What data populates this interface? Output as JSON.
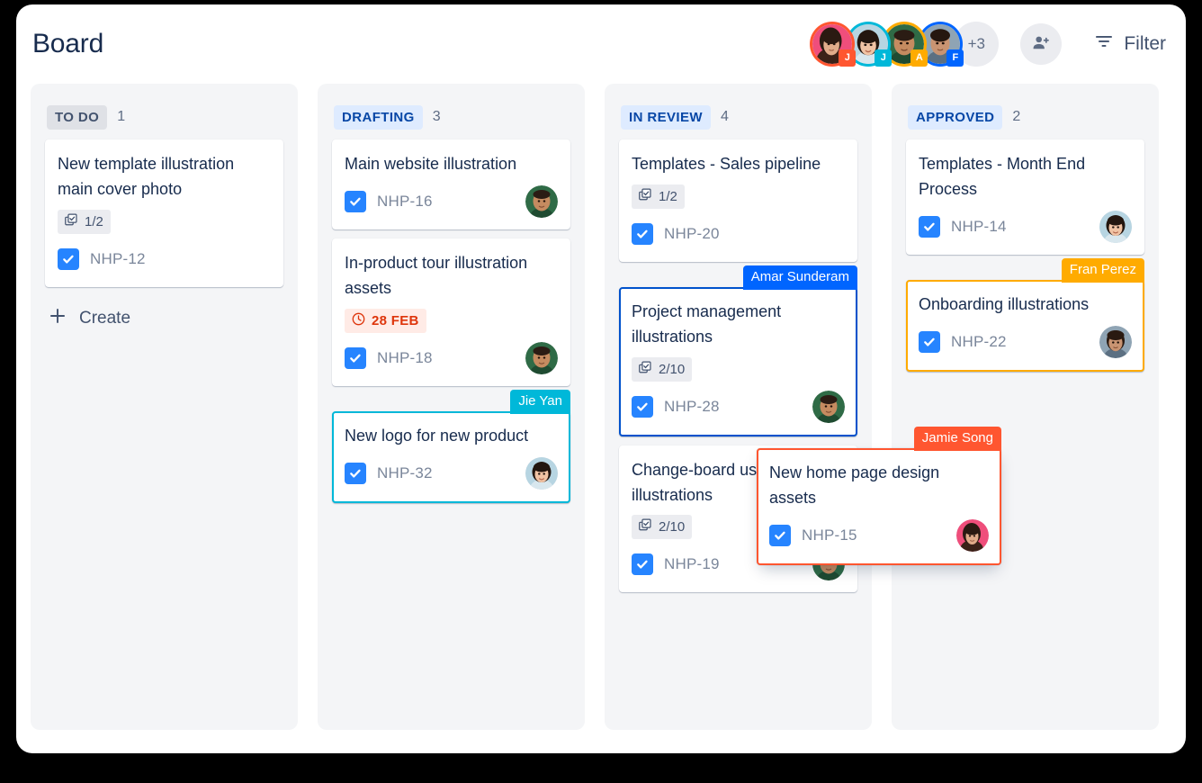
{
  "header": {
    "title": "Board",
    "avatars": [
      {
        "name": "Jamie Song",
        "initial": "J",
        "ring": "#ff5630",
        "badge": "#ff5630"
      },
      {
        "name": "Jie Yan",
        "initial": "J",
        "ring": "#00b8d9",
        "badge": "#00b8d9"
      },
      {
        "name": "Amar Sunderam",
        "initial": "A",
        "ring": "#ffab00",
        "badge": "#ffab00"
      },
      {
        "name": "Fran Perez",
        "initial": "F",
        "ring": "#0065ff",
        "badge": "#0065ff"
      }
    ],
    "more_count": "+3",
    "add_person_icon": "add-person-icon",
    "filter_icon": "filter-icon",
    "filter_label": "Filter"
  },
  "columns": [
    {
      "id": "todo",
      "name": "TO DO",
      "badge_style": "todo",
      "count": "1",
      "create_label": "Create",
      "create_icon": "plus-icon",
      "cards": [
        {
          "title": "New template illustration main cover photo",
          "subtasks": "1/2",
          "subtasks_icon": "subtasks-icon",
          "key": "NHP-12",
          "type_icon": "task-check-icon",
          "avatar": null,
          "owner_tag": null,
          "highlight": null
        }
      ]
    },
    {
      "id": "drafting",
      "name": "DRAFTING",
      "badge_style": "status",
      "count": "3",
      "cards": [
        {
          "title": "Main website illustration",
          "subtasks": null,
          "key": "NHP-16",
          "type_icon": "task-check-icon",
          "avatar": "man-green",
          "owner_tag": null,
          "highlight": null
        },
        {
          "title": "In-product tour illustration assets",
          "due_date": "28 FEB",
          "due_icon": "clock-icon",
          "key": "NHP-18",
          "type_icon": "task-check-icon",
          "avatar": "man-green",
          "owner_tag": null,
          "highlight": null
        },
        {
          "title": "New logo for new product",
          "subtasks": null,
          "key": "NHP-32",
          "type_icon": "task-check-icon",
          "avatar": "woman-cyan",
          "owner_tag": "Jie Yan",
          "owner_tag_color": "cyan",
          "highlight": "sel-cyan"
        }
      ]
    },
    {
      "id": "inreview",
      "name": "IN REVIEW",
      "badge_style": "status",
      "count": "4",
      "cards": [
        {
          "title": "Templates - Sales pipeline",
          "subtasks": "1/2",
          "subtasks_icon": "subtasks-icon",
          "key": "NHP-20",
          "type_icon": "task-check-icon",
          "avatar": null,
          "owner_tag": null,
          "highlight": null
        },
        {
          "title": "Project management illustrations",
          "subtasks": "2/10",
          "subtasks_icon": "subtasks-icon",
          "key": "NHP-28",
          "type_icon": "task-check-icon",
          "avatar": "man-green",
          "owner_tag": "Amar Sunderam",
          "owner_tag_color": "blue",
          "highlight": "sel-blue"
        },
        {
          "title": "Change-board users illustrations",
          "subtasks": "2/10",
          "subtasks_icon": "subtasks-icon",
          "key": "NHP-19",
          "type_icon": "task-check-icon",
          "avatar": "man-green",
          "owner_tag": null,
          "highlight": null
        }
      ]
    },
    {
      "id": "approved",
      "name": "APPROVED",
      "badge_style": "status",
      "count": "2",
      "cards": [
        {
          "title": "Templates - Month End Process",
          "subtasks": null,
          "key": "NHP-14",
          "type_icon": "task-check-icon",
          "avatar": "woman-cyan",
          "owner_tag": null,
          "highlight": null
        },
        {
          "title": "Onboarding illustrations",
          "subtasks": null,
          "key": "NHP-22",
          "type_icon": "task-check-icon",
          "avatar": "woman-grey",
          "owner_tag": "Fran Perez",
          "owner_tag_color": "yellow",
          "highlight": "sel-yellow"
        }
      ]
    }
  ],
  "dragging_card": {
    "title": "New home page design assets",
    "key": "NHP-15",
    "type_icon": "task-check-icon",
    "avatar": "woman-pink",
    "owner_tag": "Jamie Song",
    "owner_tag_color": "orange",
    "highlight": "sel-orange"
  }
}
